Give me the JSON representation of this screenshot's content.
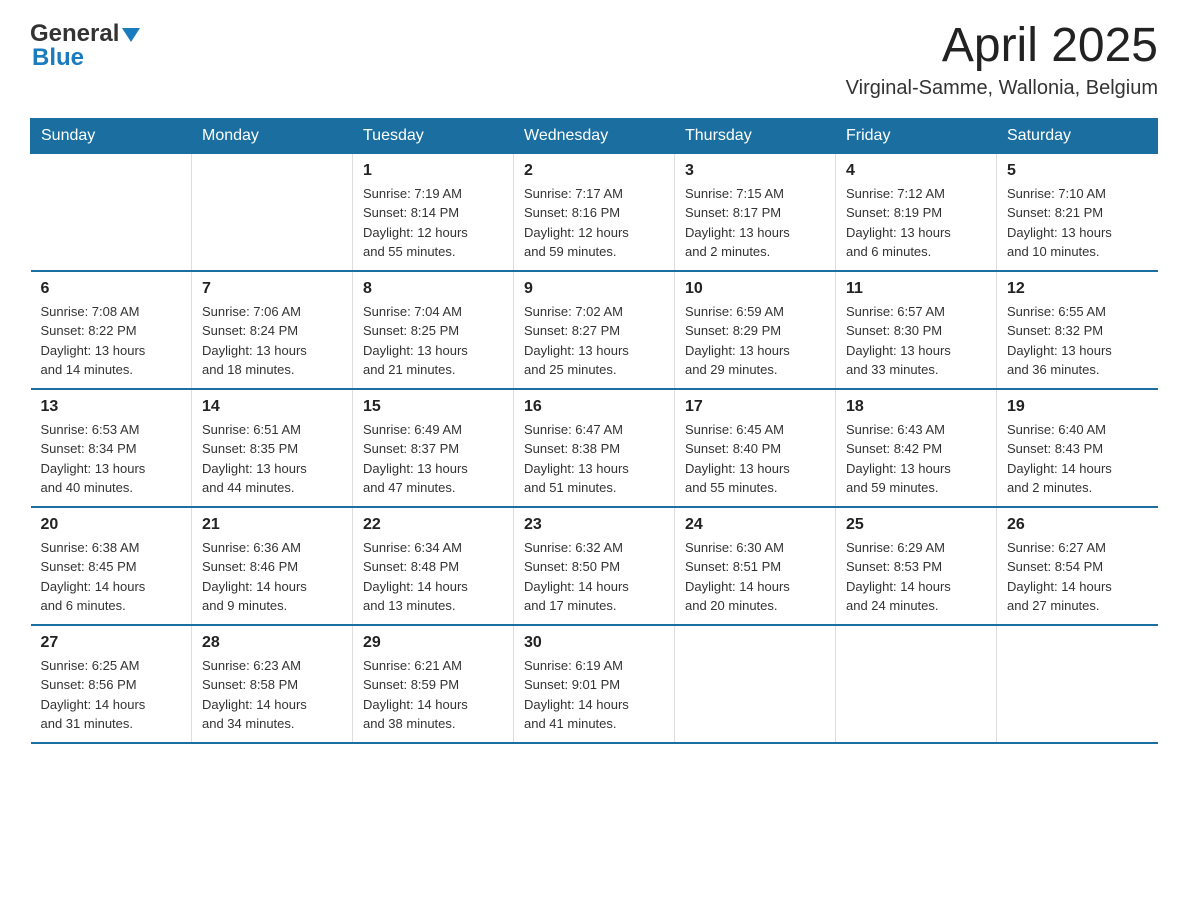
{
  "header": {
    "logo_general": "General",
    "logo_blue": "Blue",
    "month_title": "April 2025",
    "location": "Virginal-Samme, Wallonia, Belgium"
  },
  "days_of_week": [
    "Sunday",
    "Monday",
    "Tuesday",
    "Wednesday",
    "Thursday",
    "Friday",
    "Saturday"
  ],
  "weeks": [
    [
      {
        "day": "",
        "info": ""
      },
      {
        "day": "",
        "info": ""
      },
      {
        "day": "1",
        "info": "Sunrise: 7:19 AM\nSunset: 8:14 PM\nDaylight: 12 hours\nand 55 minutes."
      },
      {
        "day": "2",
        "info": "Sunrise: 7:17 AM\nSunset: 8:16 PM\nDaylight: 12 hours\nand 59 minutes."
      },
      {
        "day": "3",
        "info": "Sunrise: 7:15 AM\nSunset: 8:17 PM\nDaylight: 13 hours\nand 2 minutes."
      },
      {
        "day": "4",
        "info": "Sunrise: 7:12 AM\nSunset: 8:19 PM\nDaylight: 13 hours\nand 6 minutes."
      },
      {
        "day": "5",
        "info": "Sunrise: 7:10 AM\nSunset: 8:21 PM\nDaylight: 13 hours\nand 10 minutes."
      }
    ],
    [
      {
        "day": "6",
        "info": "Sunrise: 7:08 AM\nSunset: 8:22 PM\nDaylight: 13 hours\nand 14 minutes."
      },
      {
        "day": "7",
        "info": "Sunrise: 7:06 AM\nSunset: 8:24 PM\nDaylight: 13 hours\nand 18 minutes."
      },
      {
        "day": "8",
        "info": "Sunrise: 7:04 AM\nSunset: 8:25 PM\nDaylight: 13 hours\nand 21 minutes."
      },
      {
        "day": "9",
        "info": "Sunrise: 7:02 AM\nSunset: 8:27 PM\nDaylight: 13 hours\nand 25 minutes."
      },
      {
        "day": "10",
        "info": "Sunrise: 6:59 AM\nSunset: 8:29 PM\nDaylight: 13 hours\nand 29 minutes."
      },
      {
        "day": "11",
        "info": "Sunrise: 6:57 AM\nSunset: 8:30 PM\nDaylight: 13 hours\nand 33 minutes."
      },
      {
        "day": "12",
        "info": "Sunrise: 6:55 AM\nSunset: 8:32 PM\nDaylight: 13 hours\nand 36 minutes."
      }
    ],
    [
      {
        "day": "13",
        "info": "Sunrise: 6:53 AM\nSunset: 8:34 PM\nDaylight: 13 hours\nand 40 minutes."
      },
      {
        "day": "14",
        "info": "Sunrise: 6:51 AM\nSunset: 8:35 PM\nDaylight: 13 hours\nand 44 minutes."
      },
      {
        "day": "15",
        "info": "Sunrise: 6:49 AM\nSunset: 8:37 PM\nDaylight: 13 hours\nand 47 minutes."
      },
      {
        "day": "16",
        "info": "Sunrise: 6:47 AM\nSunset: 8:38 PM\nDaylight: 13 hours\nand 51 minutes."
      },
      {
        "day": "17",
        "info": "Sunrise: 6:45 AM\nSunset: 8:40 PM\nDaylight: 13 hours\nand 55 minutes."
      },
      {
        "day": "18",
        "info": "Sunrise: 6:43 AM\nSunset: 8:42 PM\nDaylight: 13 hours\nand 59 minutes."
      },
      {
        "day": "19",
        "info": "Sunrise: 6:40 AM\nSunset: 8:43 PM\nDaylight: 14 hours\nand 2 minutes."
      }
    ],
    [
      {
        "day": "20",
        "info": "Sunrise: 6:38 AM\nSunset: 8:45 PM\nDaylight: 14 hours\nand 6 minutes."
      },
      {
        "day": "21",
        "info": "Sunrise: 6:36 AM\nSunset: 8:46 PM\nDaylight: 14 hours\nand 9 minutes."
      },
      {
        "day": "22",
        "info": "Sunrise: 6:34 AM\nSunset: 8:48 PM\nDaylight: 14 hours\nand 13 minutes."
      },
      {
        "day": "23",
        "info": "Sunrise: 6:32 AM\nSunset: 8:50 PM\nDaylight: 14 hours\nand 17 minutes."
      },
      {
        "day": "24",
        "info": "Sunrise: 6:30 AM\nSunset: 8:51 PM\nDaylight: 14 hours\nand 20 minutes."
      },
      {
        "day": "25",
        "info": "Sunrise: 6:29 AM\nSunset: 8:53 PM\nDaylight: 14 hours\nand 24 minutes."
      },
      {
        "day": "26",
        "info": "Sunrise: 6:27 AM\nSunset: 8:54 PM\nDaylight: 14 hours\nand 27 minutes."
      }
    ],
    [
      {
        "day": "27",
        "info": "Sunrise: 6:25 AM\nSunset: 8:56 PM\nDaylight: 14 hours\nand 31 minutes."
      },
      {
        "day": "28",
        "info": "Sunrise: 6:23 AM\nSunset: 8:58 PM\nDaylight: 14 hours\nand 34 minutes."
      },
      {
        "day": "29",
        "info": "Sunrise: 6:21 AM\nSunset: 8:59 PM\nDaylight: 14 hours\nand 38 minutes."
      },
      {
        "day": "30",
        "info": "Sunrise: 6:19 AM\nSunset: 9:01 PM\nDaylight: 14 hours\nand 41 minutes."
      },
      {
        "day": "",
        "info": ""
      },
      {
        "day": "",
        "info": ""
      },
      {
        "day": "",
        "info": ""
      }
    ]
  ]
}
